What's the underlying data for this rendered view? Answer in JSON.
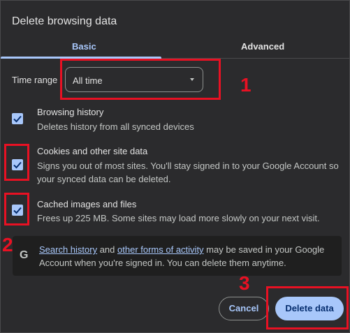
{
  "dialog": {
    "title": "Delete browsing data",
    "tabs": [
      {
        "label": "Basic",
        "active": true
      },
      {
        "label": "Advanced",
        "active": false
      }
    ],
    "time_range": {
      "label": "Time range",
      "value": "All time"
    },
    "items": [
      {
        "title": "Browsing history",
        "description": "Deletes history from all synced devices",
        "checked": true
      },
      {
        "title": "Cookies and other site data",
        "description": "Signs you out of most sites. You'll stay signed in to your Google Account so your synced data can be deleted.",
        "checked": true
      },
      {
        "title": "Cached images and files",
        "description": "Frees up 225 MB. Some sites may load more slowly on your next visit.",
        "checked": true
      }
    ],
    "info": {
      "icon": "google-g-icon",
      "link1": "Search history",
      "mid": " and ",
      "link2": "other forms of activity",
      "rest": " may be saved in your Google Account when you're signed in. You can delete them anytime."
    },
    "buttons": {
      "cancel": "Cancel",
      "delete": "Delete data"
    }
  },
  "annotations": [
    "1",
    "2",
    "3"
  ],
  "colors": {
    "accent": "#a8c7fa",
    "highlight": "#e81123",
    "background": "#2b2b2d"
  }
}
